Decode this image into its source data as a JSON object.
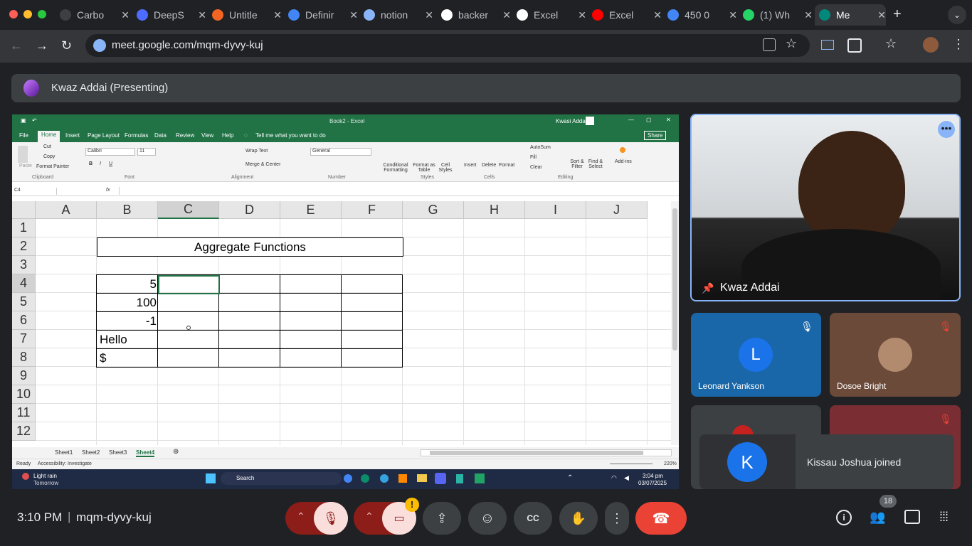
{
  "browser": {
    "tabs": [
      {
        "label": "Carbo",
        "icon": "carbon-icon",
        "color": "#3c4043"
      },
      {
        "label": "DeepS",
        "icon": "deepseek-icon",
        "color": "#4d6bfe"
      },
      {
        "label": "Untitle",
        "icon": "untitled-icon",
        "color": "#f26522"
      },
      {
        "label": "Definir",
        "icon": "docs-icon",
        "color": "#4285f4"
      },
      {
        "label": "notion",
        "icon": "search-icon",
        "color": "#8ab4f8"
      },
      {
        "label": "backer",
        "icon": "notion-icon",
        "color": "#ffffff"
      },
      {
        "label": "Excel",
        "icon": "chatgpt-icon",
        "color": "#ffffff"
      },
      {
        "label": "Excel",
        "icon": "youtube-icon",
        "color": "#ff0000"
      },
      {
        "label": "450 0",
        "icon": "google-icon",
        "color": "#4285f4"
      },
      {
        "label": "(1) Wh",
        "icon": "whatsapp-icon",
        "color": "#25d366"
      },
      {
        "label": "Me",
        "icon": "meet-icon",
        "color": "#00897b"
      }
    ],
    "url": "meet.google.com/mqm-dyvy-kuj"
  },
  "meet": {
    "presenter_label": "Kwaz Addai (Presenting)",
    "main_tile_name": "Kwaz Addai",
    "participants": [
      {
        "name": "Leonard Yankson",
        "initial": "L",
        "bg": "#1967a8",
        "avatar": "#1a73e8"
      },
      {
        "name": "Dosoe Bright",
        "initial": "",
        "bg": "#6b4a3a",
        "avatar": "#b28a6e"
      }
    ],
    "toast": {
      "initial": "K",
      "text": "Kissau Joshua joined"
    },
    "time": "3:10 PM",
    "separator": "|",
    "meeting_code": "mqm-dyvy-kuj",
    "people_count": "18"
  },
  "excel": {
    "title_book": "Book2 - Excel",
    "user": "Kwasi Addai",
    "share": "Share",
    "tabs": [
      "File",
      "Home",
      "Insert",
      "Page Layout",
      "Formulas",
      "Data",
      "Review",
      "View",
      "Help"
    ],
    "tell_me": "Tell me what you want to do",
    "ribbon": {
      "cut": "Cut",
      "copy": "Copy",
      "format_painter": "Format Painter",
      "paste": "Paste",
      "clipboard": "Clipboard",
      "font_name": "Calibri",
      "font_size": "11",
      "font": "Font",
      "wrap_text": "Wrap Text",
      "merge_center": "Merge & Center",
      "alignment": "Alignment",
      "number_format": "General",
      "number": "Number",
      "conditional": "Conditional Formatting",
      "format_table": "Format as Table",
      "cell_styles": "Cell Styles",
      "styles": "Styles",
      "insert": "Insert",
      "delete": "Delete",
      "format": "Format",
      "cells": "Cells",
      "autosum": "AutoSum",
      "fill": "Fill",
      "clear": "Clear",
      "sort": "Sort & Filter",
      "find": "Find & Select",
      "editing": "Editing",
      "addins": "Add-ins"
    },
    "name_box": "C4",
    "fx": "fx",
    "columns": [
      "A",
      "B",
      "C",
      "D",
      "E",
      "F",
      "G",
      "H",
      "I",
      "J"
    ],
    "rows": [
      "1",
      "2",
      "3",
      "4",
      "5",
      "6",
      "7",
      "8",
      "9",
      "10",
      "11",
      "12"
    ],
    "merged_title": "Aggregate Functions",
    "b_values": [
      "5",
      "100",
      "-1",
      "Hello",
      "$"
    ],
    "sheets": [
      "Sheet1",
      "Sheet2",
      "Sheet3",
      "Sheet4"
    ],
    "status": "Ready",
    "accessibility": "Accessibility: Investigate",
    "zoom": "220%"
  },
  "taskbar": {
    "weather": "Light rain",
    "weather_sub": "Tomorrow",
    "search": "Search",
    "clock_time": "3:04 pm",
    "clock_date": "03/07/2025"
  }
}
